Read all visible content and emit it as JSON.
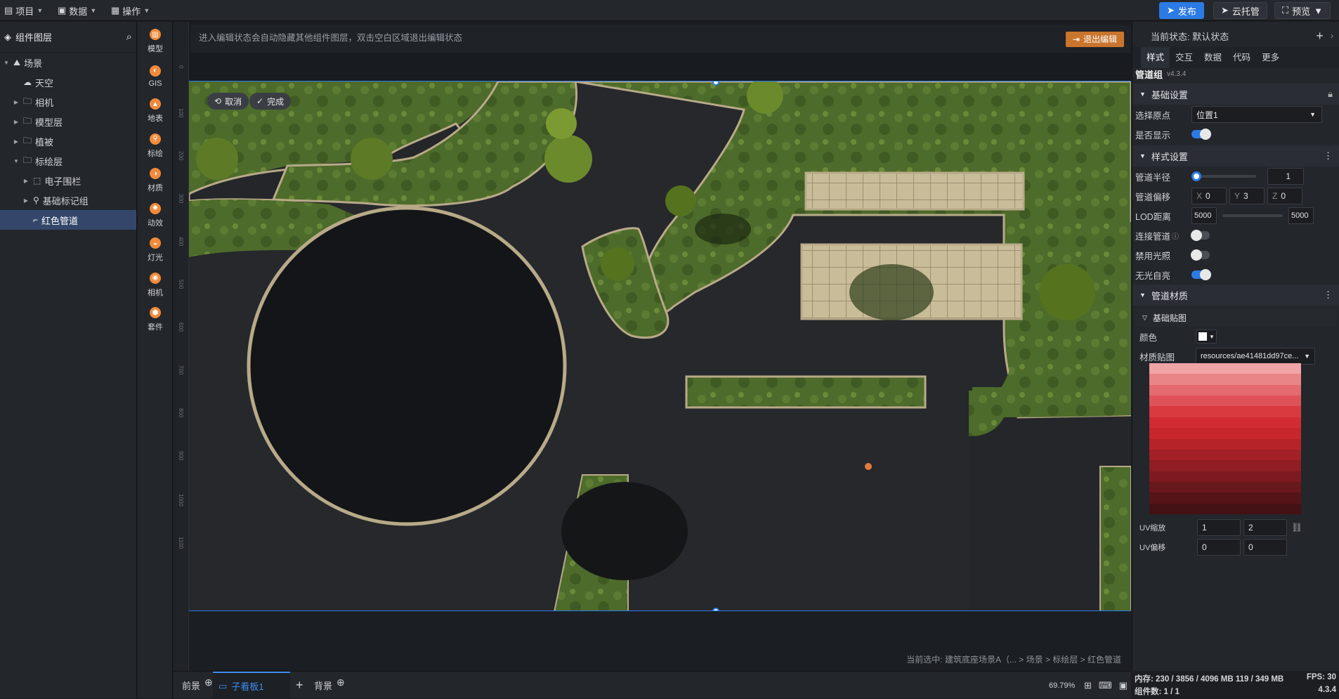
{
  "topbar": {
    "menus": [
      {
        "label": "项目",
        "icon": "file-icon"
      },
      {
        "label": "数据",
        "icon": "database-icon"
      },
      {
        "label": "操作",
        "icon": "grid-icon"
      }
    ],
    "publish_label": "发布",
    "cloud_label": "云托管",
    "preview_label": "预览"
  },
  "layers": {
    "title": "组件图层",
    "items": [
      {
        "label": "场景",
        "depth": 0,
        "caret": "open",
        "icon": "scene-icon"
      },
      {
        "label": "天空",
        "depth": 1,
        "caret": "none",
        "icon": "cloud-icon"
      },
      {
        "label": "相机",
        "depth": 1,
        "caret": "closed",
        "icon": "folder-icon"
      },
      {
        "label": "模型层",
        "depth": 1,
        "caret": "closed",
        "icon": "folder-icon"
      },
      {
        "label": "植被",
        "depth": 1,
        "caret": "closed",
        "icon": "folder-icon"
      },
      {
        "label": "标绘层",
        "depth": 1,
        "caret": "open",
        "icon": "folder-icon"
      },
      {
        "label": "电子围栏",
        "depth": 2,
        "caret": "closed",
        "icon": "fence-icon"
      },
      {
        "label": "基础标记组",
        "depth": 2,
        "caret": "closed",
        "icon": "marker-icon"
      },
      {
        "label": "红色管道",
        "depth": 2,
        "caret": "none",
        "icon": "pipe-icon",
        "selected": true
      }
    ]
  },
  "toolbox": [
    {
      "label": "模型",
      "icon": "model-icon"
    },
    {
      "label": "GIS",
      "icon": "globe-icon"
    },
    {
      "label": "地表",
      "icon": "terrain-icon"
    },
    {
      "label": "标绘",
      "icon": "pin-icon"
    },
    {
      "label": "材质",
      "icon": "material-icon"
    },
    {
      "label": "动效",
      "icon": "effect-icon"
    },
    {
      "label": "灯光",
      "icon": "light-icon"
    },
    {
      "label": "相机",
      "icon": "camera-icon"
    },
    {
      "label": "套件",
      "icon": "kit-icon"
    }
  ],
  "canvas": {
    "hint": "进入编辑状态会自动隐藏其他组件图层，双击空白区域退出编辑状态",
    "exit_label": "退出编辑",
    "cancel_label": "取消",
    "done_label": "完成",
    "ruler_ticks": [
      "0",
      "100",
      "200",
      "300",
      "400",
      "500",
      "600",
      "700",
      "800",
      "900",
      "1000",
      "1100"
    ],
    "breadcrumb": "当前选中: 建筑底座场景A（... > 场景 > 标绘层 > 红色管道"
  },
  "bottom_tabs": {
    "front_label": "前景",
    "board_label": "子看板1",
    "back_label": "背景",
    "zoom": "69.79%"
  },
  "props": {
    "state_label": "当前状态: 默认状态",
    "tabs": [
      "样式",
      "交互",
      "数据",
      "代码",
      "更多"
    ],
    "component_name": "管道组",
    "version": "v4.3.4",
    "section_basic": "基础设置",
    "origin_label": "选择原点",
    "origin_value": "位置1",
    "visible_label": "是否显示",
    "section_style": "样式设置",
    "radius_label": "管道半径",
    "radius_value": "1",
    "offset_label": "管道偏移",
    "offset_x": "0",
    "offset_y": "3",
    "offset_z": "0",
    "lod_label": "LOD距离",
    "lod_min": "5000",
    "lod_max": "5000",
    "connect_label": "连接管道",
    "nolight_label": "禁用光照",
    "selflit_label": "无光自亮",
    "section_material": "管道材质",
    "sub_basic_map": "基础贴图",
    "color_label": "颜色",
    "texture_label": "材质贴图",
    "texture_value": "resources/ae41481dd97ce...",
    "uv_scale_label": "UV缩放",
    "uv_scale_u": "1",
    "uv_scale_v": "2",
    "uv_offset_label": "UV偏移",
    "uv_offset_u": "0",
    "uv_offset_v": "0",
    "texture_colors": [
      "#f0a4a6",
      "#e98487",
      "#e46b6f",
      "#df5358",
      "#d83a40",
      "#d12c33",
      "#c8262d",
      "#b62329",
      "#a32026",
      "#8f1d22",
      "#7c1a1f",
      "#68171b",
      "#561418",
      "#441114"
    ]
  },
  "status": {
    "memory": "内存: 230 / 3856 / 4096 MB  119 / 349 MB",
    "fps": "FPS: 30",
    "count": "组件数: 1 / 1",
    "version": "4.3.4"
  },
  "colors": {
    "accent": "#2c7be5",
    "exit": "#c9752d",
    "grass": "#4d6b2a",
    "road": "#24262a",
    "curb": "#b8aa88"
  }
}
